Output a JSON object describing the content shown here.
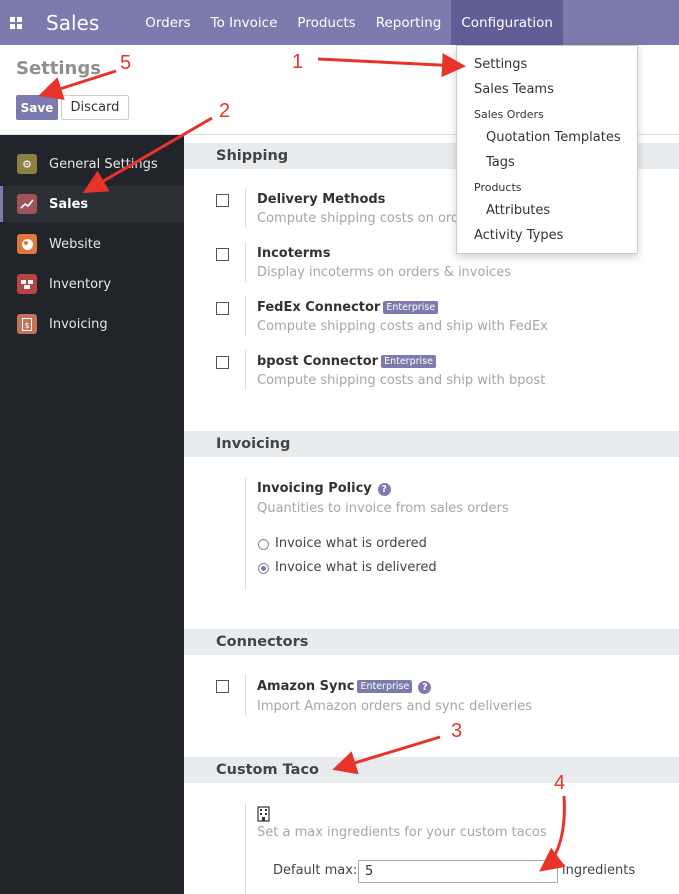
{
  "navbar": {
    "brand": "Sales",
    "items": [
      "Orders",
      "To Invoice",
      "Products",
      "Reporting",
      "Configuration"
    ]
  },
  "control_panel": {
    "title": "Settings",
    "save_label": "Save",
    "discard_label": "Discard"
  },
  "sidebar": {
    "items": [
      {
        "label": "General Settings",
        "icon": "gear-icon",
        "color": "#8a7f44"
      },
      {
        "label": "Sales",
        "icon": "chart-icon",
        "color": "#a0525a"
      },
      {
        "label": "Website",
        "icon": "globe-icon",
        "color": "#e0753e"
      },
      {
        "label": "Inventory",
        "icon": "boxes-icon",
        "color": "#b84545"
      },
      {
        "label": "Invoicing",
        "icon": "invoice-icon",
        "color": "#c4725c"
      }
    ]
  },
  "shipping": {
    "title": "Shipping",
    "settings": [
      {
        "title": "Delivery Methods",
        "desc": "Compute shipping costs on orders"
      },
      {
        "title": "Incoterms",
        "desc": "Display incoterms on orders & invoices"
      },
      {
        "title": "FedEx Connector",
        "badge": "Enterprise",
        "desc": "Compute shipping costs and ship with FedEx"
      },
      {
        "title": "bpost Connector",
        "badge": "Enterprise",
        "desc": "Compute shipping costs and ship with bpost"
      }
    ]
  },
  "invoicing": {
    "title": "Invoicing",
    "policy_title": "Invoicing Policy",
    "policy_desc": "Quantities to invoice from sales orders",
    "options": [
      "Invoice what is ordered",
      "Invoice what is delivered"
    ],
    "selected_index": 1
  },
  "connectors": {
    "title": "Connectors",
    "amazon_title": "Amazon Sync",
    "amazon_badge": "Enterprise",
    "amazon_desc": "Import Amazon orders and sync deliveries"
  },
  "custom_taco": {
    "title": "Custom Taco",
    "icon": "building-icon",
    "desc": "Set a max ingredients for your custom tacos",
    "field_label": "Default max:",
    "field_value": "5",
    "field_suffix": "ingredients"
  },
  "config_menu": {
    "settings": "Settings",
    "sales_teams": "Sales Teams",
    "sales_orders_header": "Sales Orders",
    "quotation_templates": "Quotation Templates",
    "tags": "Tags",
    "products_header": "Products",
    "attributes": "Attributes",
    "activity_types": "Activity Types"
  },
  "annotations": {
    "color": "#e8332b",
    "labels": [
      "1",
      "2",
      "3",
      "4",
      "5"
    ]
  }
}
